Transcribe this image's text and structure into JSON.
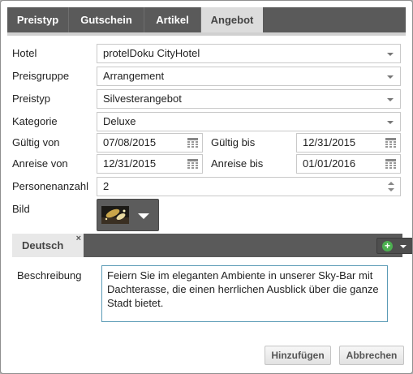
{
  "tabs": [
    "Preistyp",
    "Gutschein",
    "Artikel",
    "Angebot"
  ],
  "active_tab": "Angebot",
  "form": {
    "hotel": {
      "label": "Hotel",
      "value": "protelDoku CityHotel"
    },
    "preisgruppe": {
      "label": "Preisgruppe",
      "value": "Arrangement"
    },
    "preistyp": {
      "label": "Preistyp",
      "value": "Silvesterangebot"
    },
    "kategorie": {
      "label": "Kategorie",
      "value": "Deluxe"
    },
    "gueltig_von": {
      "label": "Gültig von",
      "value": "07/08/2015"
    },
    "gueltig_bis": {
      "label": "Gültig bis",
      "value": "12/31/2015"
    },
    "anreise_von": {
      "label": "Anreise von",
      "value": "12/31/2015"
    },
    "anreise_bis": {
      "label": "Anreise bis",
      "value": "01/01/2016"
    },
    "personenanzahl": {
      "label": "Personenanzahl",
      "value": "2"
    },
    "bild": {
      "label": "Bild"
    }
  },
  "language_tab": {
    "label": "Deutsch",
    "close": "×"
  },
  "beschreibung": {
    "label": "Beschreibung",
    "text": "Feiern Sie im eleganten Ambiente in unserer Sky-Bar mit Dachterasse, die einen herrlichen Ausblick über die ganze Stadt bietet."
  },
  "buttons": {
    "add": "Hinzufügen",
    "cancel": "Abbrechen"
  },
  "icons": {
    "select_caret": "chevron-down-icon",
    "date": "calendar-icon",
    "spinner": "spinner-icon",
    "add": "plus-circle-icon"
  },
  "colors": {
    "tabbar": "#5a5a5a",
    "active_tab": "#dcdcdc",
    "description_border": "#5b9bb6",
    "add_icon": "#4caf50"
  }
}
